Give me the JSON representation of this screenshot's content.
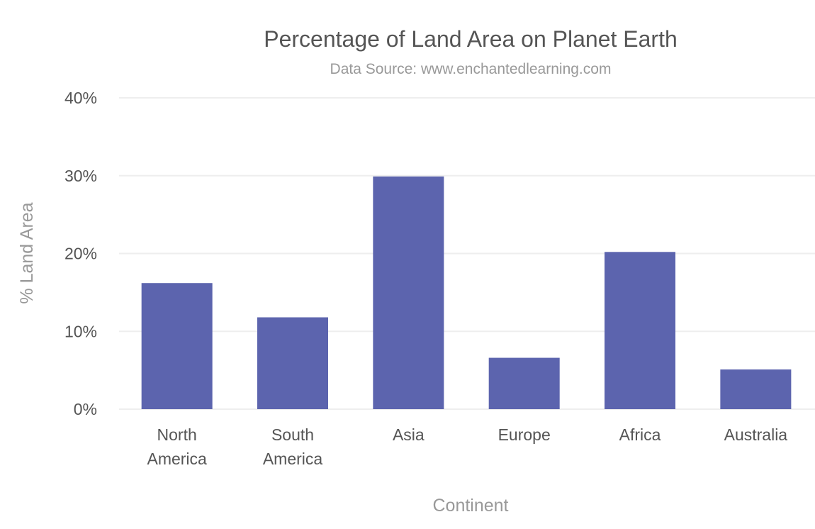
{
  "chart_data": {
    "type": "bar",
    "title": "Percentage of Land Area on Planet Earth",
    "subtitle": "Data Source: www.enchantedlearning.com",
    "xlabel": "Continent",
    "ylabel": "% Land Area",
    "categories": [
      [
        "North",
        "America"
      ],
      [
        "South",
        "America"
      ],
      [
        "Asia"
      ],
      [
        "Europe"
      ],
      [
        "Africa"
      ],
      [
        "Australia"
      ]
    ],
    "category_names": [
      "North America",
      "South America",
      "Asia",
      "Europe",
      "Africa",
      "Australia"
    ],
    "values": [
      16.2,
      11.8,
      29.9,
      6.6,
      20.2,
      5.1
    ],
    "value_format": "percent",
    "ylim": [
      0,
      40
    ],
    "yticks": [
      0,
      10,
      20,
      30,
      40
    ],
    "ytick_labels": [
      "0%",
      "10%",
      "20%",
      "30%",
      "40%"
    ],
    "grid": true,
    "legend": "none",
    "bar_color": "#5c64ae"
  }
}
